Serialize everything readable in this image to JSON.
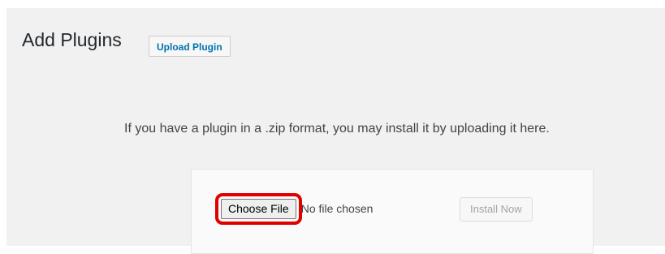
{
  "header": {
    "title": "Add Plugins",
    "upload_button_label": "Upload Plugin"
  },
  "upload": {
    "instructions": "If you have a plugin in a .zip format, you may install it by uploading it here.",
    "choose_file_label": "Choose File",
    "file_status": "No file chosen",
    "install_button_label": "Install Now"
  },
  "colors": {
    "background": "#f1f1f1",
    "link_blue": "#0073aa",
    "highlight_red": "#e00000",
    "disabled_text": "#a0a5aa"
  }
}
